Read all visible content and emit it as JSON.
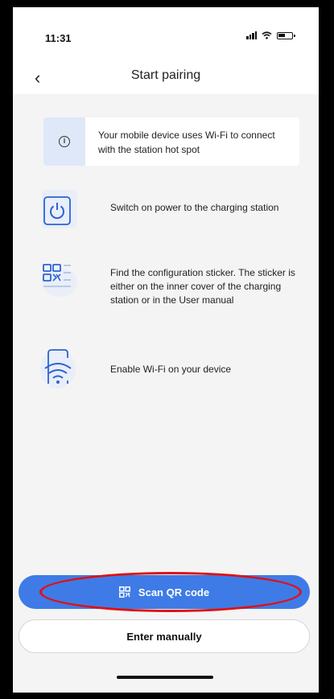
{
  "status_bar": {
    "time": "11:31"
  },
  "nav": {
    "back_glyph": "‹",
    "title": "Start pairing"
  },
  "info": {
    "icon": "info-icon",
    "icon_glyph": "i",
    "text": "Your mobile device uses Wi-Fi to connect with the station hot spot"
  },
  "steps": [
    {
      "icon": "power-icon",
      "text": "Switch on power to the charging station"
    },
    {
      "icon": "qr-sticker-icon",
      "text": "Find the configuration sticker. The sticker is either on the inner cover of the charging station or in the User manual"
    },
    {
      "icon": "wifi-phone-icon",
      "text": "Enable Wi-Fi on your device"
    }
  ],
  "buttons": {
    "scan_label": "Scan QR code",
    "scan_icon": "qr-code-icon",
    "manual_label": "Enter manually"
  },
  "colors": {
    "accent": "#3f7be6",
    "icon_accent": "#2a63d4",
    "info_bg": "#dfe8f8",
    "highlight": "#e01010"
  }
}
